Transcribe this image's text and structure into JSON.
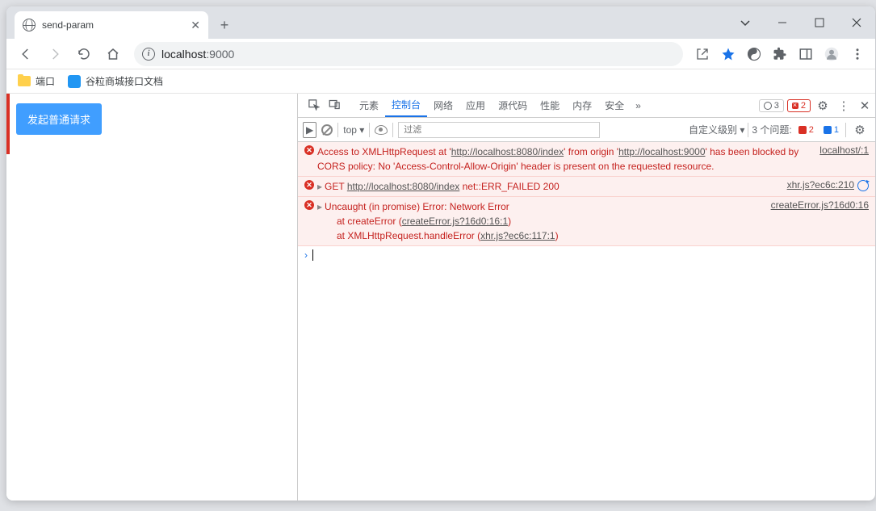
{
  "browser": {
    "tab_title": "send-param",
    "url_host": "localhost",
    "url_port": ":9000",
    "bookmarks": [
      {
        "type": "folder",
        "label": "端口"
      },
      {
        "type": "site",
        "label": "谷粒商城接口文档"
      }
    ]
  },
  "page": {
    "button_label": "发起普通请求"
  },
  "devtools": {
    "tabs": [
      "元素",
      "控制台",
      "网络",
      "应用",
      "源代码",
      "性能",
      "内存",
      "安全"
    ],
    "active_tab": "控制台",
    "badge_error_count": "3",
    "badge_warn_count": "2",
    "filter": {
      "context_label": "top ▾",
      "placeholder": "过滤",
      "level_label": "自定义级别 ▾",
      "issues_label": "3 个问题:",
      "issue_err_count": "2",
      "issue_info_count": "1"
    },
    "console": {
      "line1": {
        "pre": "Access to XMLHttpRequest at '",
        "url1": "http://localhost:8080/index",
        "mid1": "' from origin '",
        "url2": "http://localhost:9000",
        "post": "' has been blocked by CORS policy: No 'Access-Control-Allow-Origin' header is present on the requested resource.",
        "src": "localhost/:1"
      },
      "line2": {
        "method": "GET",
        "url": "http://localhost:8080/index",
        "err": "net::ERR_FAILED 200",
        "src": "xhr.js?ec6c:210"
      },
      "line3": {
        "head": "Uncaught (in promise) Error: Network Error",
        "at1_pre": "at createError (",
        "at1_link": "createError.js?16d0:16:1",
        "at2_pre": "at XMLHttpRequest.handleError (",
        "at2_link": "xhr.js?ec6c:117:1",
        "src": "createError.js?16d0:16"
      }
    }
  }
}
